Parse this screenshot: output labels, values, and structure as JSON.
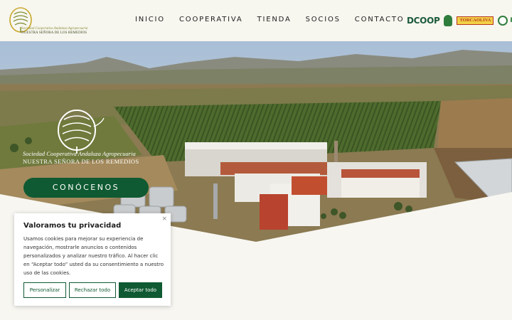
{
  "header": {
    "logo": {
      "line1": "Sociedad Cooperativa Andaluza Agropecuaria",
      "line2": "NUESTRA SEÑORA DE LOS REMEDIOS"
    },
    "nav": [
      {
        "label": "INICIO"
      },
      {
        "label": "COOPERATIVA"
      },
      {
        "label": "TIENDA"
      },
      {
        "label": "SOCIOS"
      },
      {
        "label": "CONTACTO"
      }
    ],
    "partners": {
      "dcoop": "DCOOP",
      "torcaoliva": "TORCAOLIVA",
      "last": "R"
    }
  },
  "hero": {
    "line1": "Sociedad Cooperativa Andaluza Agropecuaria",
    "line2": "NUESTRA SEÑORA DE LOS REMEDIOS",
    "cta": "CONÓCENOS"
  },
  "cookie": {
    "close": "×",
    "title": "Valoramos tu privacidad",
    "body": "Usamos cookies para mejorar su experiencia de navegación, mostrarle anuncios o contenidos personalizados y analizar nuestro tráfico. Al hacer clic en “Aceptar todo” usted da su consentimiento a nuestro uso de las cookies.",
    "customize": "Personalizar",
    "reject": "Rechazar todo",
    "accept": "Aceptar todo"
  },
  "colors": {
    "brand_green": "#0f5a32",
    "header_bg": "#f7f6ef",
    "olive": "#8a8d35"
  }
}
